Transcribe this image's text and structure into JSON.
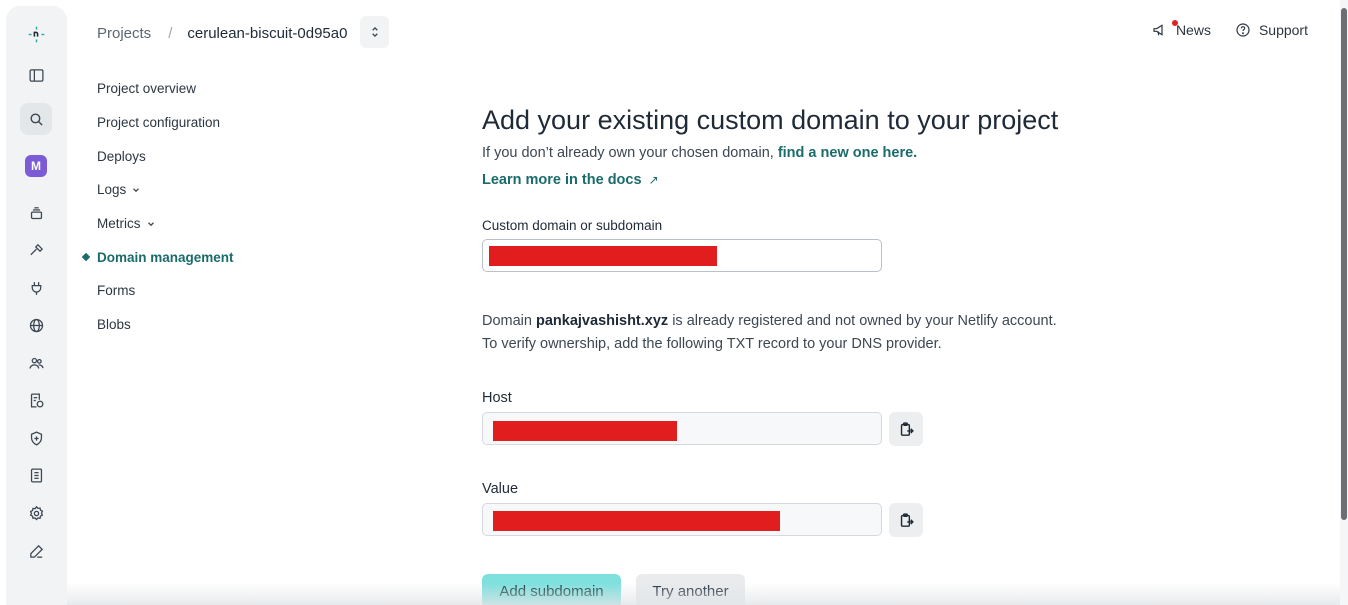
{
  "rail": {
    "avatar_letter": "M",
    "icons": [
      "netlify-logo-icon",
      "sidebar-toggle-icon",
      "search-icon",
      "team-avatar",
      "layers-icon",
      "hammer-icon",
      "plug-icon",
      "globe-icon",
      "users-icon",
      "billing-icon",
      "shield-icon",
      "book-icon",
      "gear-icon",
      "pen-icon"
    ]
  },
  "header": {
    "breadcrumb_root": "Projects",
    "breadcrumb_separator": "/",
    "project_name": "cerulean-biscuit-0d95a0",
    "news_label": "News",
    "support_label": "Support"
  },
  "subnav": {
    "items": [
      {
        "label": "Project overview"
      },
      {
        "label": "Project configuration"
      },
      {
        "label": "Deploys"
      },
      {
        "label": "Logs"
      },
      {
        "label": "Metrics"
      },
      {
        "label": "Domain management"
      },
      {
        "label": "Forms"
      },
      {
        "label": "Blobs"
      }
    ]
  },
  "main": {
    "title": "Add your existing custom domain to your project",
    "intro_text": "If you don’t already own your chosen domain, ",
    "intro_link": "find a new one here.",
    "docs_link": "Learn more in the docs",
    "docs_arrow": "↗",
    "domain_label": "Custom domain or subdomain",
    "notice_prefix": "Domain ",
    "notice_domain": "pankajvashisht.xyz",
    "notice_suffix": " is already registered and not owned by your Netlify account.",
    "notice_line2": "To verify ownership, add the following TXT record to your DNS provider.",
    "host_label": "Host",
    "value_label": "Value",
    "add_button": "Add subdomain",
    "try_button": "Try another"
  },
  "colors": {
    "accent": "#1b6b6b",
    "primary_button": "#7ee0dc",
    "redaction": "#e11d1d"
  }
}
